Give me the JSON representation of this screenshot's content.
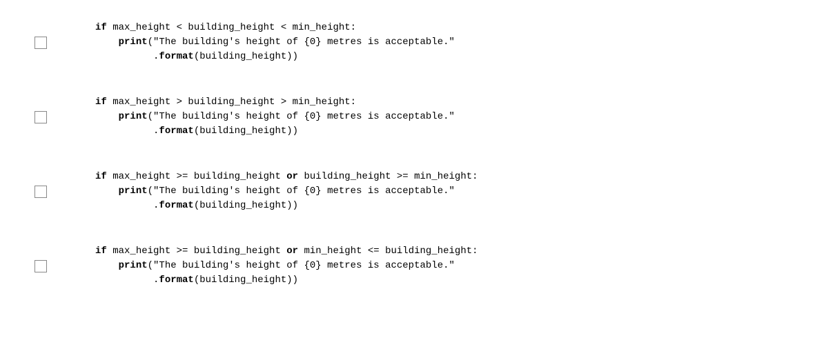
{
  "options": [
    {
      "line1_prefix": "if",
      "line1_body": " max_height < building_height < min_height:",
      "line2_prefix": "    ",
      "line2_kw": "print",
      "line2_body": "(\"The building's height of {0} metres is acceptable.\"",
      "line3_prefix": "          .",
      "line3_kw": "format",
      "line3_body": "(building_height))"
    },
    {
      "line1_prefix": "if",
      "line1_body": " max_height > building_height > min_height:",
      "line2_prefix": "    ",
      "line2_kw": "print",
      "line2_body": "(\"The building's height of {0} metres is acceptable.\"",
      "line3_prefix": "          .",
      "line3_kw": "format",
      "line3_body": "(building_height))"
    },
    {
      "line1_prefix": "if",
      "line1_body_a": " max_height >= building_height ",
      "line1_kw2": "or",
      "line1_body_b": " building_height >= min_height:",
      "line2_prefix": "    ",
      "line2_kw": "print",
      "line2_body": "(\"The building's height of {0} metres is acceptable.\"",
      "line3_prefix": "          .",
      "line3_kw": "format",
      "line3_body": "(building_height))"
    },
    {
      "line1_prefix": "if",
      "line1_body_a": " max_height >= building_height ",
      "line1_kw2": "or",
      "line1_body_b": " min_height <= building_height:",
      "line2_prefix": "    ",
      "line2_kw": "print",
      "line2_body": "(\"The building's height of {0} metres is acceptable.\"",
      "line3_prefix": "          .",
      "line3_kw": "format",
      "line3_body": "(building_height))"
    }
  ]
}
